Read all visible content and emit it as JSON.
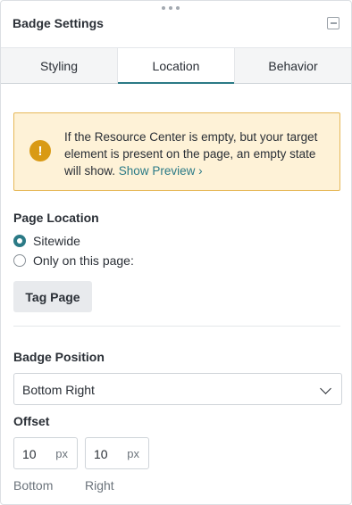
{
  "header": {
    "title": "Badge Settings"
  },
  "tabs": [
    {
      "label": "Styling",
      "active": false
    },
    {
      "label": "Location",
      "active": true
    },
    {
      "label": "Behavior",
      "active": false
    }
  ],
  "alert": {
    "icon": "!",
    "message": "If the Resource Center is empty, but your target element is present on the page, an empty state will show.",
    "link_label": "Show Preview ›",
    "icon_name": "warning-icon",
    "color": "#fef2d7"
  },
  "page_location": {
    "label": "Page Location",
    "options": [
      {
        "label": "Sitewide",
        "checked": true
      },
      {
        "label": "Only on this page:",
        "checked": false
      }
    ],
    "tag_button_label": "Tag Page"
  },
  "badge_position": {
    "label": "Badge Position",
    "selected": "Bottom Right"
  },
  "offset": {
    "label": "Offset",
    "fields": [
      {
        "value": "10",
        "unit": "px",
        "caption": "Bottom"
      },
      {
        "value": "10",
        "unit": "px",
        "caption": "Right"
      }
    ]
  },
  "colors": {
    "accent": "#2b7a86",
    "warning": "#d99a14"
  }
}
